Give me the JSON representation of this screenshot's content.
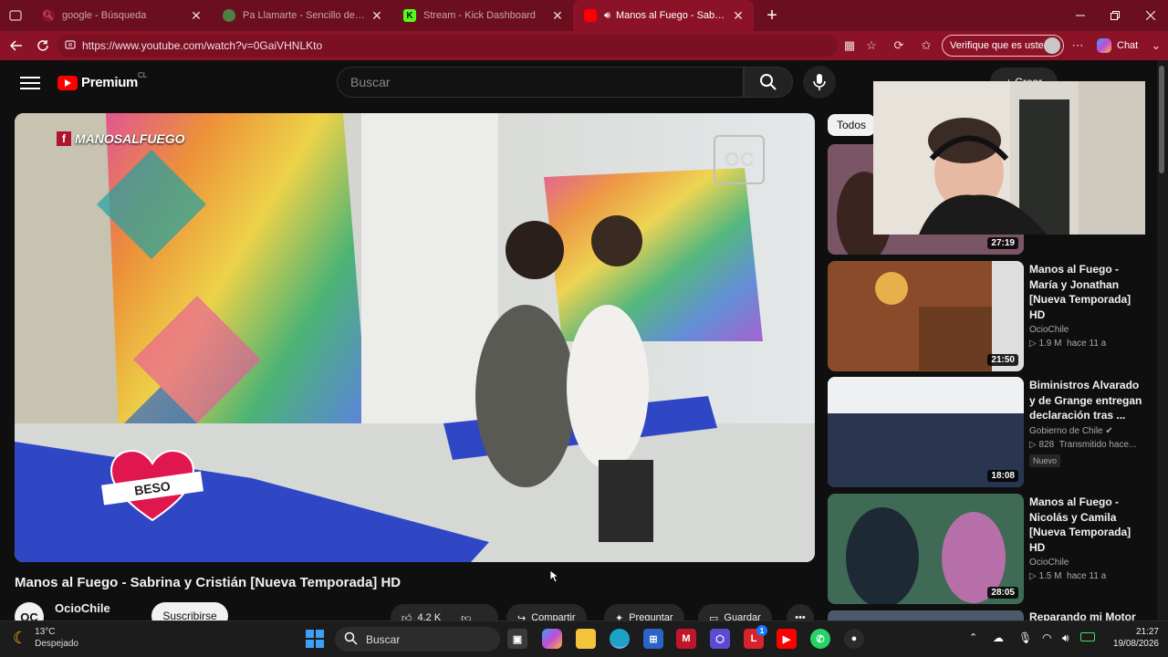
{
  "browser": {
    "tabs": [
      {
        "label": "google - Búsqueda",
        "icon": "google-icon",
        "close": "✕"
      },
      {
        "label": "Pa Llamarte - Sencillo de Bayron F",
        "icon": "spotify-icon",
        "close": "✕"
      },
      {
        "label": "Stream - Kick Dashboard",
        "icon": "kick-icon",
        "close": "✕"
      },
      {
        "label": "Manos al Fuego - Sabrina y Cr",
        "icon": "youtube-icon",
        "close": "✕"
      }
    ],
    "new_tab": "+",
    "url": "https://www.youtube.com/watch?v=0GaiVHNLKto",
    "verify_label": "Verifique que es usted",
    "chat_label": "Chat",
    "accent": "#8c1327"
  },
  "youtube": {
    "logo_text": "Premium",
    "country": "CL",
    "search_placeholder": "Buscar",
    "create_label": "+ Crear",
    "video": {
      "title": "Manos al Fuego - Sabrina y Cristián [Nueva Temporada] HD",
      "overlay_brand": "MANOSALFUEGO",
      "heart_label": "BESO",
      "channel_logo": "OC"
    },
    "channel": {
      "name": "OcioChile",
      "avatar": "OC",
      "subscribe": "Suscribirse"
    },
    "actions": {
      "likes": "4,2 K",
      "share": "Compartir",
      "ask": "Preguntar",
      "save": "Guardar",
      "more": "•••"
    },
    "filter_chip": "Todos",
    "recommended": [
      {
        "title": "",
        "channel": "",
        "views": "",
        "age": "",
        "duration": "27:19"
      },
      {
        "title": "Manos al Fuego - María y Jonathan [Nueva Temporada] HD",
        "channel": "OcioChile",
        "views": "1.9 M",
        "age": "hace 11 a",
        "duration": "21:50"
      },
      {
        "title": "Biministros Alvarado y de Grange entregan declaración tras ...",
        "channel": "Gobierno de Chile",
        "views": "828",
        "age": "Transmitido hace...",
        "duration": "18:08",
        "badge": "Nuevo"
      },
      {
        "title": "Manos al Fuego - Nicolás y Camila [Nueva Temporada] HD",
        "channel": "OcioChile",
        "views": "1.5 M",
        "age": "hace 11 a",
        "duration": "28:05"
      },
      {
        "title": "Reparando mi Motor",
        "channel": "",
        "views": "",
        "age": "",
        "duration": ""
      }
    ]
  },
  "taskbar": {
    "weather_temp": "13°C",
    "weather_desc": "Despejado",
    "search_placeholder": "Buscar",
    "time": "21:27",
    "date": "19/08/2026",
    "badge_count": "1"
  }
}
